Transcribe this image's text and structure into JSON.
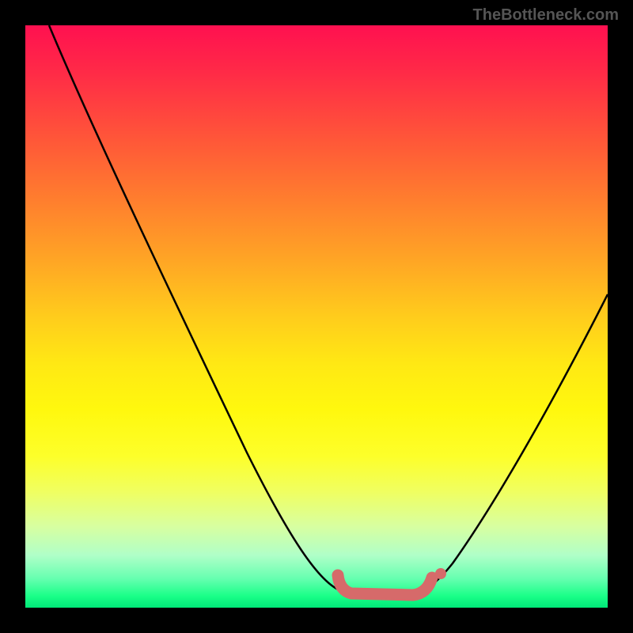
{
  "attribution": "TheBottleneck.com",
  "chart_data": {
    "type": "line",
    "title": "",
    "xlabel": "",
    "ylabel": "",
    "xlim": [
      0,
      100
    ],
    "ylim": [
      0,
      100
    ],
    "series": [
      {
        "name": "bottleneck-curve",
        "x": [
          4,
          10,
          20,
          30,
          40,
          50,
          54,
          58,
          62,
          66,
          70,
          76,
          84,
          92,
          100
        ],
        "values": [
          100,
          87,
          69,
          52,
          35,
          17,
          8,
          3,
          2,
          2,
          3,
          8,
          22,
          40,
          60
        ]
      }
    ],
    "optimal_region": {
      "x_start": 54,
      "x_end": 70,
      "y": 3
    },
    "gradient_stops": [
      {
        "pct": 0,
        "color": "#ff1050"
      },
      {
        "pct": 50,
        "color": "#ffcc1c"
      },
      {
        "pct": 80,
        "color": "#f0ff60"
      },
      {
        "pct": 100,
        "color": "#00e878"
      }
    ]
  }
}
